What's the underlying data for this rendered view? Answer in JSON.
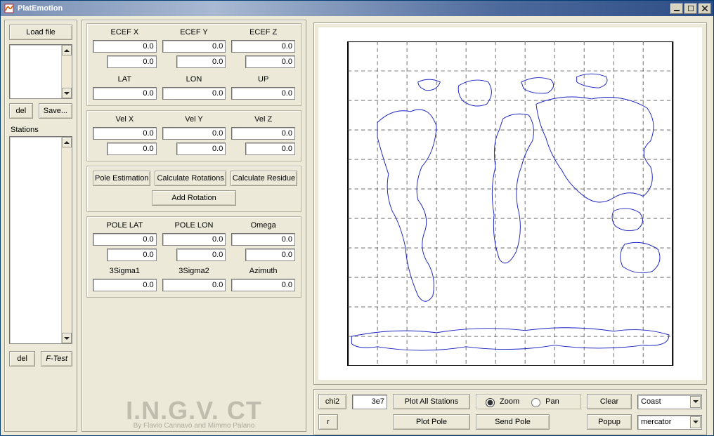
{
  "window": {
    "title": "PlatEmotion"
  },
  "left": {
    "load_file": "Load file",
    "del": "del",
    "save": "Save...",
    "stations_label": "Stations",
    "ftest": "F-Test"
  },
  "mid": {
    "ecef": {
      "hx": "ECEF X",
      "hy": "ECEF Y",
      "hz": "ECEF Z",
      "x1": "0.0",
      "y1": "0.0",
      "z1": "0.0",
      "x2": "0.0",
      "y2": "0.0",
      "z2": "0.0"
    },
    "geo": {
      "hlat": "LAT",
      "hlon": "LON",
      "hup": "UP",
      "lat": "0.0",
      "lon": "0.0",
      "up": "0.0"
    },
    "vel": {
      "hx": "Vel X",
      "hy": "Vel Y",
      "hz": "Vel Z",
      "x1": "0.0",
      "y1": "0.0",
      "z1": "0.0",
      "x2": "0.0",
      "y2": "0.0",
      "z2": "0.0"
    },
    "buttons": {
      "pole_est": "Pole Estimation",
      "calc_rot": "Calculate Rotations",
      "calc_res": "Calculate Residue",
      "add_rot": "Add Rotation"
    },
    "pole": {
      "hlat": "POLE LAT",
      "hlon": "POLE LON",
      "homega": "Omega",
      "lat1": "0.0",
      "lon1": "0.0",
      "om1": "0.0",
      "lat2": "0.0",
      "lon2": "0.0",
      "om2": "0.0"
    },
    "sigma": {
      "h1": "3Sigma1",
      "h2": "3Sigma2",
      "haz": "Azimuth",
      "s1": "0.0",
      "s2": "0.0",
      "az": "0.0"
    },
    "watermark_big": "I.N.G.V. CT",
    "watermark_small": "By Flavio Cannavò and Mimmo Palano"
  },
  "right": {
    "chi2": "chi2",
    "chi2_val": "3e7",
    "plot_all": "Plot All Stations",
    "zoom": "Zoom",
    "pan": "Pan",
    "clear": "Clear",
    "coast": "Coast",
    "r": "r",
    "plot_pole": "Plot Pole",
    "send_pole": "Send Pole",
    "popup": "Popup",
    "projection": "mercator"
  }
}
